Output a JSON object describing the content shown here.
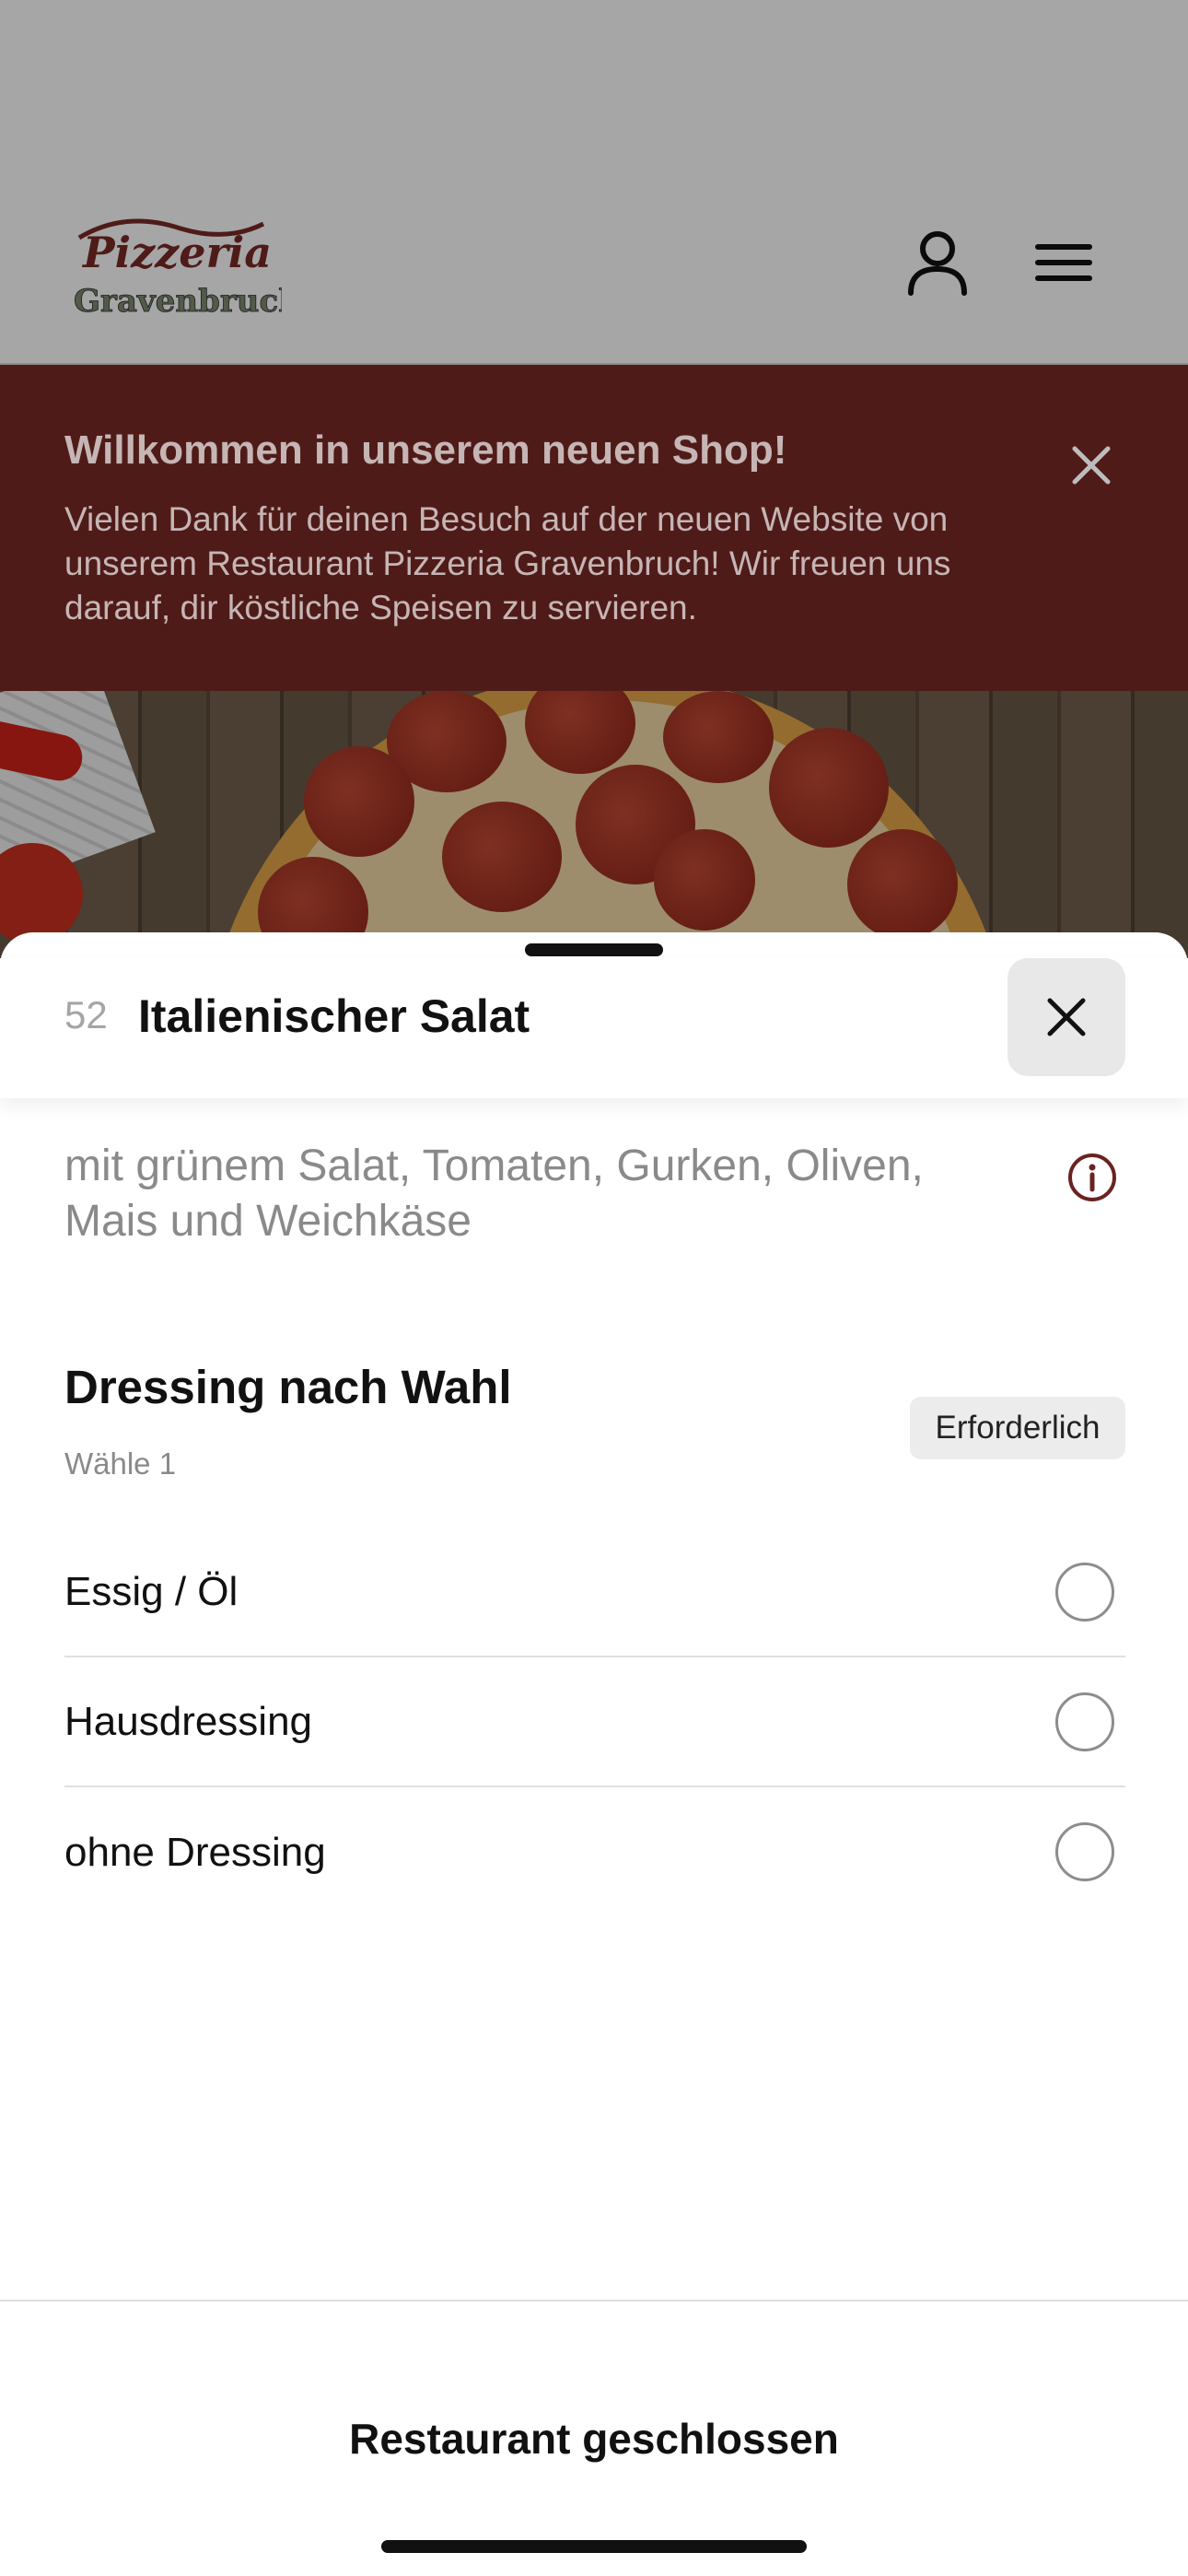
{
  "header": {
    "logo_line1": "Pizzeria",
    "logo_line2": "Gravenbruch",
    "account_icon": "user-icon",
    "menu_icon": "hamburger-menu-icon"
  },
  "banner": {
    "title": "Willkommen in unserem neuen Shop!",
    "text": "Vielen Dank für deinen Besuch auf der neuen Website von unserem Restaurant Pizzeria Gravenbruch! Wir freuen uns darauf, dir köstliche Speisen zu servieren.",
    "close_icon": "close-icon",
    "background_color": "#7a2a26"
  },
  "item": {
    "number": "52",
    "title": "Italienischer Salat",
    "description": "mit grünem Salat, Tomaten, Gurken, Oliven, Mais und Weichkäse",
    "info_icon": "info-icon",
    "close_icon": "close-icon"
  },
  "option_group": {
    "title": "Dressing nach Wahl",
    "subtitle": "Wähle 1",
    "badge": "Erforderlich",
    "options": [
      {
        "label": "Essig / Öl",
        "selected": false
      },
      {
        "label": "Hausdressing",
        "selected": false
      },
      {
        "label": "ohne Dressing",
        "selected": false
      }
    ]
  },
  "footer": {
    "status": "Restaurant geschlossen"
  },
  "colors": {
    "accent": "#7a2a26",
    "badge_bg": "#ececec",
    "muted_text": "#8a8a8a"
  }
}
